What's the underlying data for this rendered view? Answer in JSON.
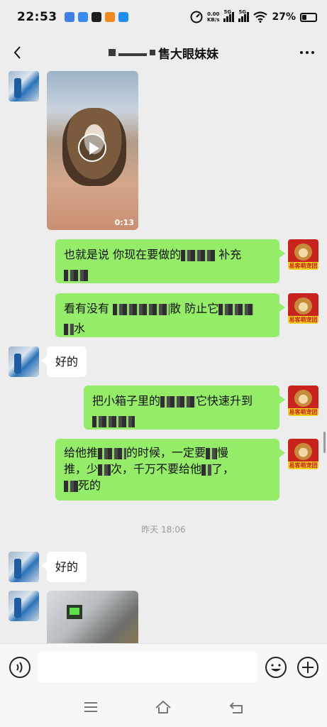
{
  "status_bar": {
    "time": "22:53",
    "network_speed_value": "0.00",
    "network_speed_unit": "KB/s",
    "sim1_tag": "5G",
    "sim2_tag": "5G",
    "battery": "27%",
    "battery_level": 0.27,
    "app_icon_colors": [
      "#3f7ee8",
      "#3a8bf0",
      "#1e1e1e",
      "#f08a1d",
      "#1e8ef0"
    ]
  },
  "header": {
    "title": "售大眼妹妹",
    "back_icon": "chevron-left-icon",
    "more_icon": "ellipsis-icon"
  },
  "messages": [
    {
      "side": "left",
      "type": "video",
      "duration": "0:13"
    },
    {
      "side": "right",
      "type": "text",
      "line1a": "也就是说 你现在要做的",
      "line1b": "补充"
    },
    {
      "side": "right",
      "type": "text",
      "line1a": "看有没有",
      "line1b": "散 防止它",
      "line2": "水"
    },
    {
      "side": "left",
      "type": "text",
      "text": "好的"
    },
    {
      "side": "right",
      "type": "text",
      "line1a": "把小箱子里的",
      "line1b": "它快速升到"
    },
    {
      "side": "right",
      "type": "text",
      "line1a": "给他推",
      "line1b": "的时候，一定要",
      "line1c": "慢",
      "line2a": "推，少",
      "line2b": "次，千万不要给他",
      "line2c": "了，",
      "line3": "死的"
    },
    {
      "side": "left",
      "type": "text",
      "text": "好的"
    },
    {
      "side": "left",
      "type": "image"
    }
  ],
  "timestamp": "昨天 18:06",
  "avatar_right_caption": "易客萌宠团队",
  "colors": {
    "my_bubble": "#95ec69",
    "other_bubble": "#ffffff",
    "background": "#ededed"
  }
}
